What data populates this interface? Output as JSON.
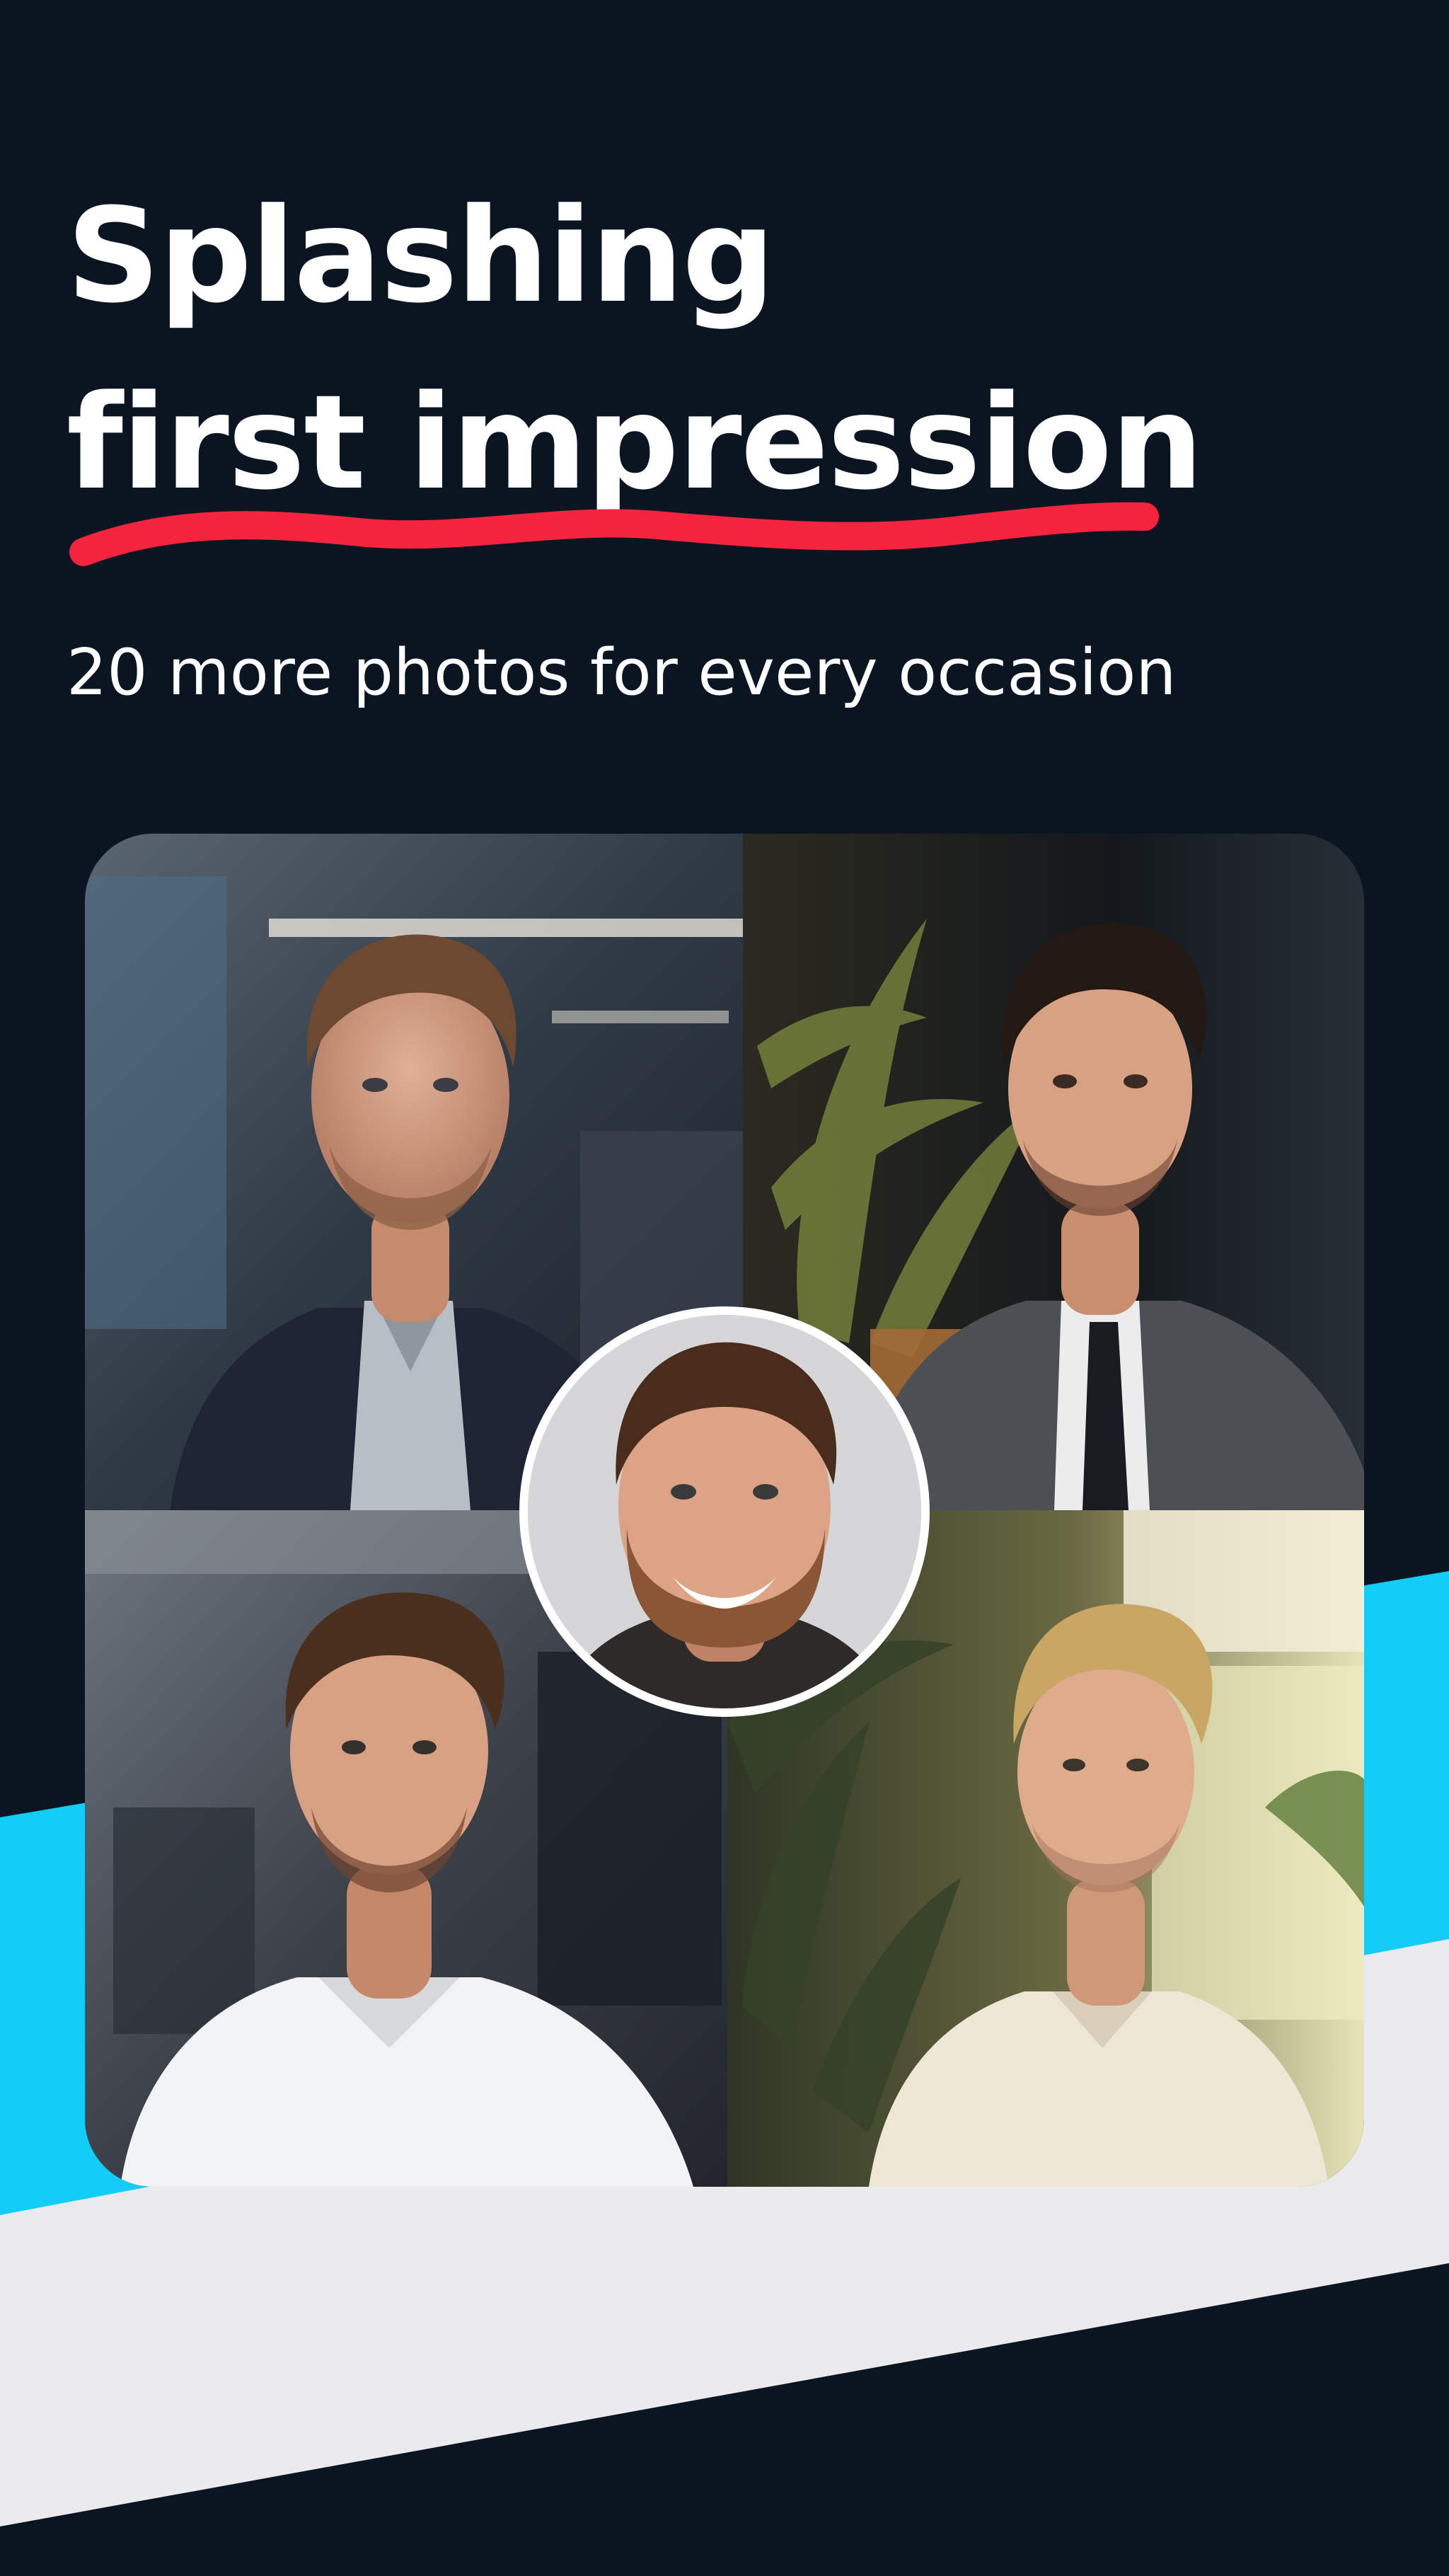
{
  "headline": {
    "line1": "Splashing",
    "line2": "first impression"
  },
  "subtitle": "20 more photos for every occasion",
  "colors": {
    "background": "#0b1421",
    "accent_underline": "#f4243f",
    "stripe_cyan": "#13cdf6",
    "stripe_light": "#ebebed",
    "text": "#ffffff"
  },
  "photos": [
    {
      "name": "portrait-office-navy-suit",
      "description_icon": "person-portrait"
    },
    {
      "name": "portrait-plant-grey-suit",
      "description_icon": "person-portrait"
    },
    {
      "name": "portrait-office-white-shirt",
      "description_icon": "person-portrait"
    },
    {
      "name": "portrait-garden-cream-shirt",
      "description_icon": "person-portrait"
    }
  ],
  "avatar": {
    "name": "source-selfie",
    "description_icon": "person-portrait"
  }
}
